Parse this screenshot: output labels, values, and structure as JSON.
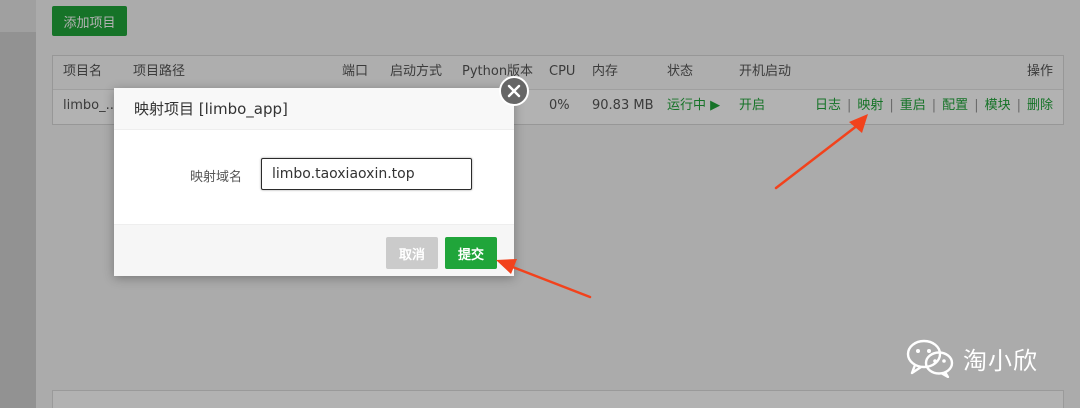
{
  "toolbar": {
    "add_label": "添加项目"
  },
  "table": {
    "headers": {
      "name": "项目名",
      "path": "项目路径",
      "port": "端口",
      "start_mode": "启动方式",
      "python_version": "Python版本",
      "cpu": "CPU",
      "memory": "内存",
      "status": "状态",
      "autostart": "开机启动",
      "ops": "操作"
    },
    "row": {
      "name": "limbo_...",
      "cpu": "0%",
      "memory": "90.83 MB",
      "status": "运行中 ▶",
      "autostart": "开启",
      "ops": [
        "日志",
        "映射",
        "重启",
        "配置",
        "模块",
        "删除"
      ]
    }
  },
  "dialog": {
    "title": "映射项目 [limbo_app]",
    "domain_label": "映射域名",
    "domain_value": "limbo.taoxiaoxin.top",
    "cancel_label": "取消",
    "submit_label": "提交"
  },
  "watermark": {
    "text": "淘小欣",
    "icon": "wechat-icon"
  },
  "colors": {
    "accent": "#20a53a",
    "arrow": "#f2421c"
  }
}
